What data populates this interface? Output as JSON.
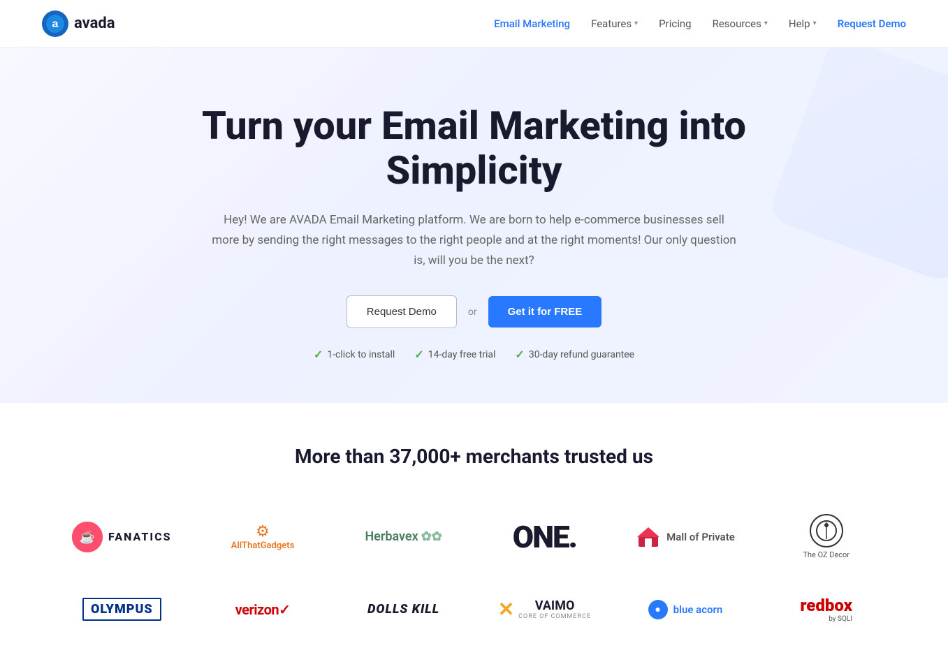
{
  "header": {
    "logo_text": "avada",
    "nav": {
      "email_marketing": "Email Marketing",
      "features": "Features",
      "pricing": "Pricing",
      "resources": "Resources",
      "help": "Help",
      "request_demo": "Request Demo"
    }
  },
  "hero": {
    "heading": "Turn your Email Marketing into Simplicity",
    "subtext": "Hey! We are AVADA Email Marketing platform. We are born to help e-commerce businesses sell more by sending the right messages to the right people and at the right moments! Our only question is, will you be the next?",
    "btn_demo": "Request Demo",
    "btn_or": "or",
    "btn_free": "Get it for FREE",
    "badges": [
      "1-click to install",
      "14-day free trial",
      "30-day refund guarantee"
    ]
  },
  "merchants": {
    "heading": "More than 37,000+ merchants trusted us",
    "row1": [
      {
        "id": "fanatics",
        "label": "FANATICS"
      },
      {
        "id": "allthatgadgets",
        "label": "AllThatGadgets"
      },
      {
        "id": "herbavex",
        "label": "Herbavex"
      },
      {
        "id": "one",
        "label": "ONE."
      },
      {
        "id": "mallofprivate",
        "label": "Mall of Private"
      },
      {
        "id": "ozdecor",
        "label": "The OZ Decor"
      }
    ],
    "row2": [
      {
        "id": "olympus",
        "label": "OLYMPUS"
      },
      {
        "id": "verizon",
        "label": "verizon✓"
      },
      {
        "id": "dollskill",
        "label": "DOLLS KILL"
      },
      {
        "id": "vaimo",
        "label": "VAIMO"
      },
      {
        "id": "blueacorn",
        "label": "blue acorn"
      },
      {
        "id": "redbox",
        "label": "redbox"
      }
    ]
  }
}
